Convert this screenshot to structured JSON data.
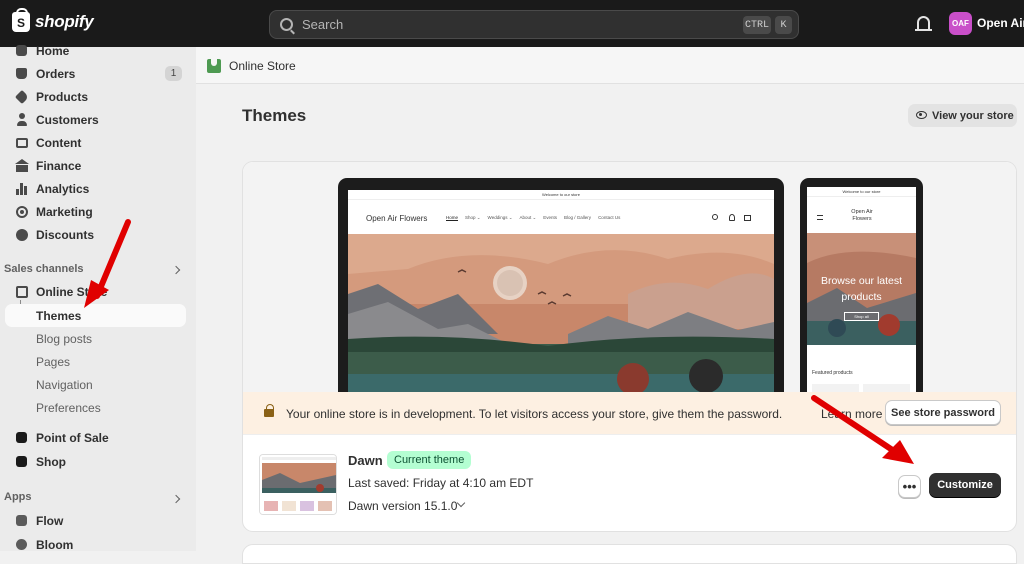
{
  "topbar": {
    "logo_text": "shopify",
    "search_placeholder": "Search",
    "shortcut_ctrl": "CTRL",
    "shortcut_key": "K",
    "avatar_initials": "OAF",
    "store_name": "Open Air F"
  },
  "sidebar": {
    "items": [
      {
        "label": "Home"
      },
      {
        "label": "Orders",
        "badge": "1"
      },
      {
        "label": "Products"
      },
      {
        "label": "Customers"
      },
      {
        "label": "Content"
      },
      {
        "label": "Finance"
      },
      {
        "label": "Analytics"
      },
      {
        "label": "Marketing"
      },
      {
        "label": "Discounts"
      }
    ],
    "sales_channels_heading": "Sales channels",
    "online_store": "Online Store",
    "sub_items": [
      {
        "label": "Themes"
      },
      {
        "label": "Blog posts"
      },
      {
        "label": "Pages"
      },
      {
        "label": "Navigation"
      },
      {
        "label": "Preferences"
      }
    ],
    "point_of_sale": "Point of Sale",
    "shop": "Shop",
    "apps_heading": "Apps",
    "apps": [
      {
        "label": "Flow"
      },
      {
        "label": "Bloom"
      }
    ]
  },
  "breadcrumb": {
    "label": "Online Store"
  },
  "page": {
    "title": "Themes",
    "view_store_label": "View your store"
  },
  "preview": {
    "announcement": "Welcome to our store",
    "site_name": "Open Air Flowers",
    "nav": [
      "Home",
      "Shop ⌄",
      "Weddings ⌄",
      "About ⌄",
      "Events",
      "Blog / Gallery",
      "Contact Us"
    ],
    "mobile_announcement": "Welcome to our store",
    "mobile_site_name_1": "Open Air",
    "mobile_site_name_2": "Flowers",
    "mobile_hero_1": "Browse our latest",
    "mobile_hero_2": "products",
    "mobile_button": "Shop all",
    "mobile_section": "Featured products"
  },
  "banner": {
    "message": "Your online store is in development. To let visitors access your store, give them the password.",
    "learn_more": "Learn more",
    "password_button": "See store password"
  },
  "theme": {
    "name": "Dawn",
    "badge": "Current theme",
    "last_saved": "Last saved: Friday at 4:10 am EDT",
    "version": "Dawn version 15.1.0",
    "more_label": "•••",
    "customize_label": "Customize"
  },
  "colors": {
    "accent_badge": "#b4fed2",
    "annotation_arrow": "#e00000"
  }
}
